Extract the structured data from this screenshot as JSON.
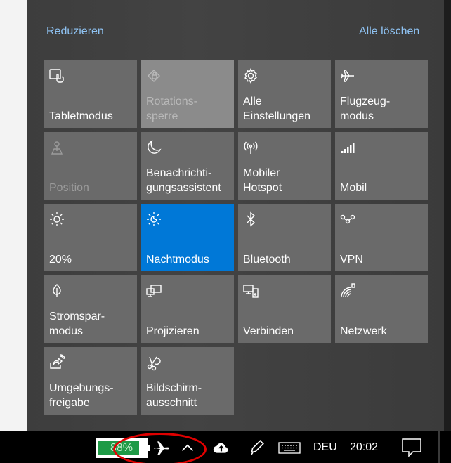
{
  "action_center": {
    "collapse_label": "Reduzieren",
    "clear_all_label": "Alle löschen"
  },
  "tiles": [
    {
      "label": "Tabletmodus",
      "icon": "tablet-mode-icon",
      "state": "normal"
    },
    {
      "label": "Rotations-\nsperre",
      "icon": "rotation-lock-icon",
      "state": "disabled-highlight"
    },
    {
      "label": "Alle\nEinstellungen",
      "icon": "settings-gear-icon",
      "state": "normal"
    },
    {
      "label": "Flugzeug-\nmodus",
      "icon": "airplane-icon",
      "state": "normal"
    },
    {
      "label": "Position",
      "icon": "location-icon",
      "state": "disabled"
    },
    {
      "label": "Benachrichti-\ngungsassistent",
      "icon": "moon-icon",
      "state": "normal"
    },
    {
      "label": "Mobiler\nHotspot",
      "icon": "hotspot-icon",
      "state": "normal"
    },
    {
      "label": "Mobil",
      "icon": "cellular-icon",
      "state": "normal"
    },
    {
      "label": "20%",
      "icon": "brightness-icon",
      "state": "normal"
    },
    {
      "label": "Nachtmodus",
      "icon": "night-light-icon",
      "state": "active"
    },
    {
      "label": "Bluetooth",
      "icon": "bluetooth-icon",
      "state": "normal"
    },
    {
      "label": "VPN",
      "icon": "vpn-icon",
      "state": "normal"
    },
    {
      "label": "Stromspar-\nmodus",
      "icon": "battery-saver-icon",
      "state": "normal"
    },
    {
      "label": "Projizieren",
      "icon": "project-icon",
      "state": "normal"
    },
    {
      "label": "Verbinden",
      "icon": "connect-icon",
      "state": "normal"
    },
    {
      "label": "Netzwerk",
      "icon": "network-icon",
      "state": "normal"
    },
    {
      "label": "Umgebungs-\nfreigabe",
      "icon": "nearby-sharing-icon",
      "state": "normal"
    },
    {
      "label": "Bildschirm-\nausschnitt",
      "icon": "snip-icon",
      "state": "normal"
    }
  ],
  "taskbar": {
    "battery_percent": "88%",
    "battery_level": 0.88,
    "language": "DEU",
    "time": "20:02",
    "icons": [
      "airplane-icon",
      "chevron-up-icon",
      "cloud-upload-icon",
      "pen-icon",
      "keyboard-icon",
      "notifications-icon"
    ]
  },
  "colors": {
    "accent": "#0078d7",
    "tile": "#6a6a6a",
    "link": "#8fc3f3",
    "battery_fill": "#1e9a46",
    "annotation_ring": "#e00000"
  }
}
